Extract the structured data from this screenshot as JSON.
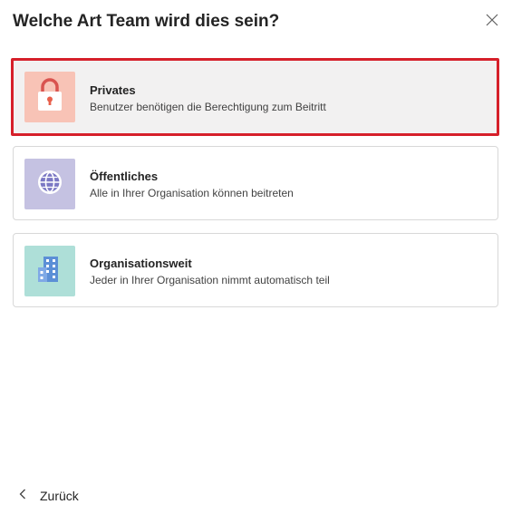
{
  "dialog": {
    "title": "Welche Art Team wird dies sein?",
    "close_icon": "close-icon"
  },
  "options": [
    {
      "name": "Privates",
      "description": "Benutzer benötigen die Berechtigung zum Beitritt",
      "icon": "lock-icon",
      "tile_color": "#f8c3b6",
      "selected": true
    },
    {
      "name": "Öffentliches",
      "description": "Alle in Ihrer Organisation können beitreten",
      "icon": "globe-icon",
      "tile_color": "#c5c2e2",
      "selected": false
    },
    {
      "name": "Organisationsweit",
      "description": "Jeder in Ihrer Organisation nimmt automatisch teil",
      "icon": "building-icon",
      "tile_color": "#aedfd8",
      "selected": false
    }
  ],
  "footer": {
    "back_label": "Zurück",
    "back_icon": "chevron-left-icon"
  },
  "colors": {
    "selection_border": "#d6202a",
    "selected_background": "#f2f1f1"
  }
}
